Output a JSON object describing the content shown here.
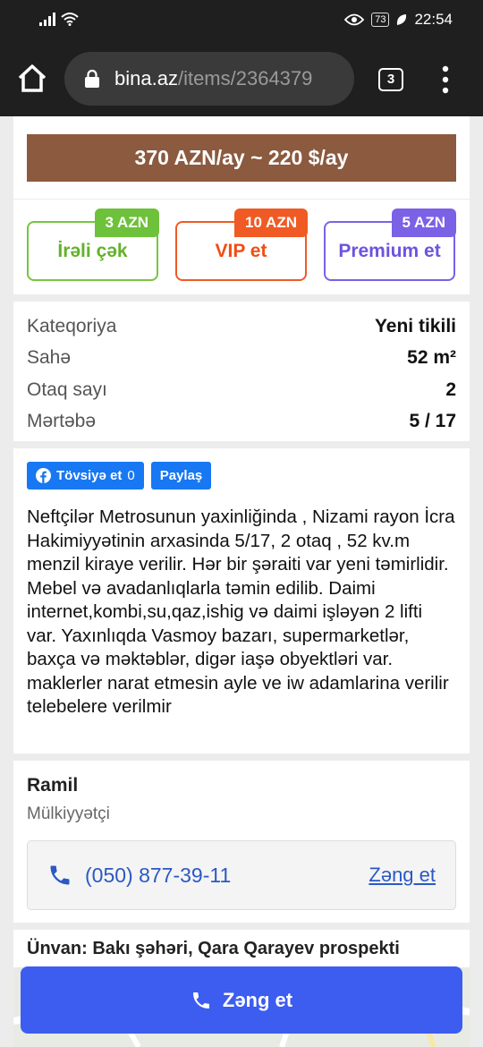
{
  "status_bar": {
    "battery": "73",
    "time": "22:54"
  },
  "browser": {
    "url_host": "bina.az",
    "url_path": "/items/2364379",
    "tab_count": "3"
  },
  "price": {
    "label": "370 AZN/ay ~ 220 $/ay"
  },
  "promo": [
    {
      "label": "İrəli çək",
      "price": "3 AZN",
      "color": "#6ec13a"
    },
    {
      "label": "VIP et",
      "price": "10 AZN",
      "color": "#f05a24"
    },
    {
      "label": "Premium et",
      "price": "5 AZN",
      "color": "#7b61e6"
    }
  ],
  "properties": [
    {
      "key": "Kateqoriya",
      "value": "Yeni tikili"
    },
    {
      "key": "Sahə",
      "value": "52 m²"
    },
    {
      "key": "Otaq sayı",
      "value": "2"
    },
    {
      "key": "Mərtəbə",
      "value": "5 / 17"
    }
  ],
  "share": {
    "recommend_label": "Tövsiyə et",
    "recommend_count": "0",
    "share_label": "Paylaş"
  },
  "description": "Neftçilər Metrosunun yaxinliğinda , Nizami rayon İcra Hakimiyyətinin arxasinda 5/17, 2 otaq , 52 kv.m menzil kiraye verilir. Hər bir şəraiti var yeni təmirlidir. Mebel və avadanlıqlarla təmin edilib. Daimi internet,kombi,su,qaz,ishig və daimi işləyən 2 lifti var. Yaxınlıqda Vasmoy bazarı, supermarketlər, baxça və məktəblər, digər iaşə obyektləri var. maklerler narat etmesin ayle ve iw adamlarina verilir telebelere verilmir",
  "owner": {
    "name": "Ramil",
    "role": "Mülkiyyətçi",
    "phone": "(050) 877-39-11",
    "call_link": "Zəng et"
  },
  "address": {
    "label": "Ünvan: Bakı şəhəri, Qara Qarayev prospekti"
  },
  "call_button": {
    "label": "Zəng et"
  },
  "colors": {
    "price_bar": "#8b5a3f",
    "primary_button": "#3d5cf0",
    "link": "#2b59c3",
    "facebook": "#1877f2"
  }
}
